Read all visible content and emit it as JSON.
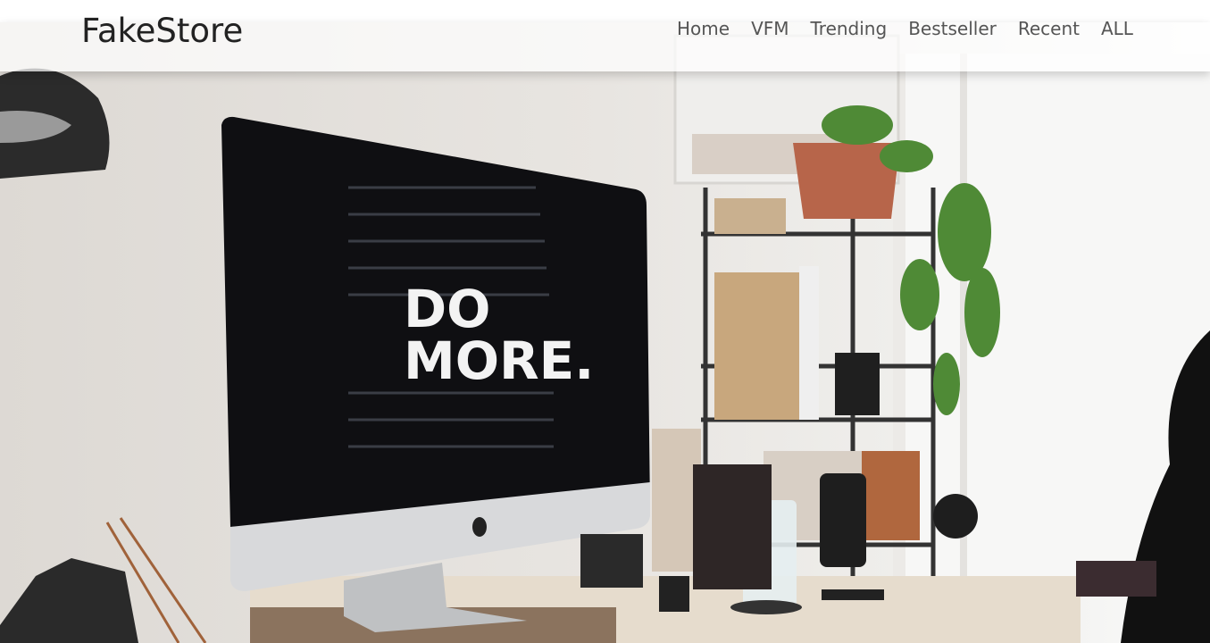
{
  "brand": {
    "name": "FakeStore"
  },
  "nav": [
    {
      "label": "Home"
    },
    {
      "label": "VFM"
    },
    {
      "label": "Trending"
    },
    {
      "label": "Bestseller"
    },
    {
      "label": "Recent"
    },
    {
      "label": "ALL"
    }
  ],
  "hero": {
    "screen_text_line1": "DO",
    "screen_text_line2": "MORE."
  }
}
